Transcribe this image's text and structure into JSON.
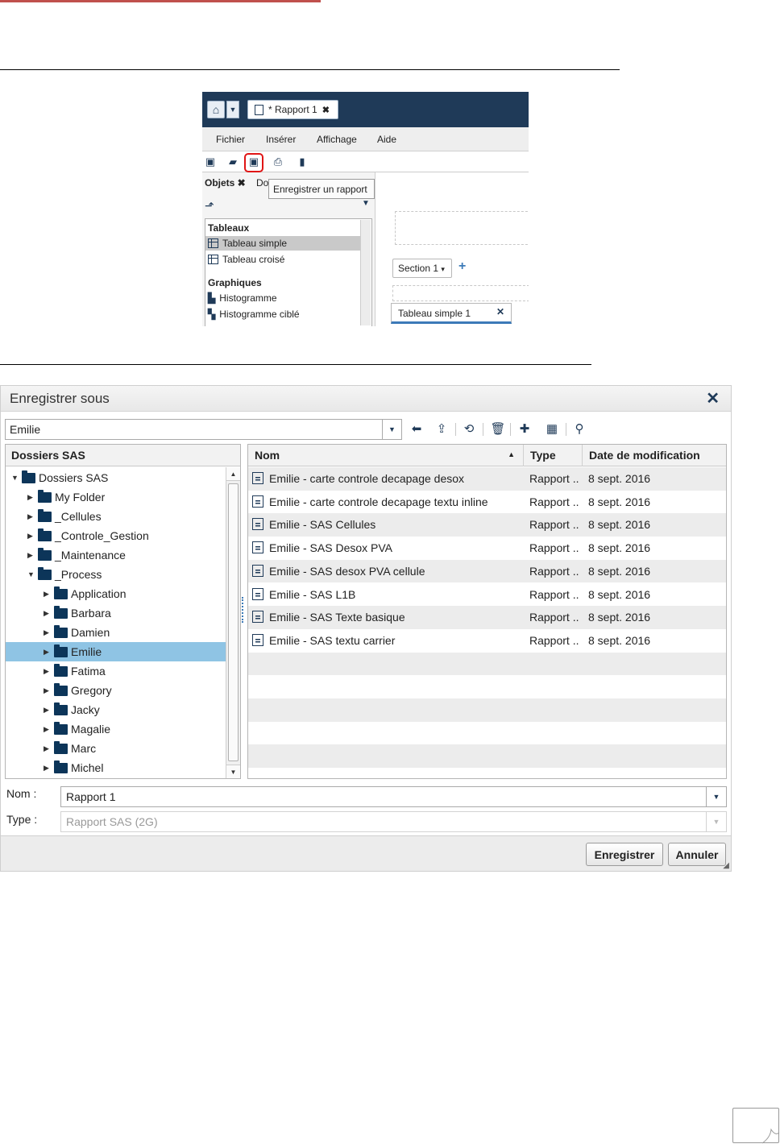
{
  "top_shot": {
    "report_tab": "* Rapport 1",
    "menu": [
      "Fichier",
      "Insérer",
      "Affichage",
      "Aide"
    ],
    "panel_tab_objects": "Objets",
    "panel_tab_data": "Do",
    "tooltip": "Enregistrer un rapport",
    "list": {
      "group1": "Tableaux",
      "item1": "Tableau simple",
      "item2": "Tableau croisé",
      "group2": "Graphiques",
      "item3": "Histogramme",
      "item4": "Histogramme ciblé"
    },
    "section_tab": "Section 1",
    "content_tab": "Tableau simple 1"
  },
  "dialog": {
    "title": "Enregistrer sous",
    "path": "Emilie",
    "tree_header": "Dossiers SAS",
    "tree": [
      {
        "label": "Dossiers SAS",
        "level": 0,
        "expanded": true
      },
      {
        "label": "My Folder",
        "level": 1,
        "expanded": false
      },
      {
        "label": "_Cellules",
        "level": 1,
        "expanded": false
      },
      {
        "label": "_Controle_Gestion",
        "level": 1,
        "expanded": false
      },
      {
        "label": "_Maintenance",
        "level": 1,
        "expanded": false
      },
      {
        "label": "_Process",
        "level": 1,
        "expanded": true
      },
      {
        "label": "Application",
        "level": 2,
        "expanded": false
      },
      {
        "label": "Barbara",
        "level": 2,
        "expanded": false
      },
      {
        "label": "Damien",
        "level": 2,
        "expanded": false
      },
      {
        "label": "Emilie",
        "level": 2,
        "expanded": false,
        "selected": true
      },
      {
        "label": "Fatima",
        "level": 2,
        "expanded": false
      },
      {
        "label": "Gregory",
        "level": 2,
        "expanded": false
      },
      {
        "label": "Jacky",
        "level": 2,
        "expanded": false
      },
      {
        "label": "Magalie",
        "level": 2,
        "expanded": false
      },
      {
        "label": "Marc",
        "level": 2,
        "expanded": false
      },
      {
        "label": "Michel",
        "level": 2,
        "expanded": false
      }
    ],
    "columns": [
      "Nom",
      "Type",
      "Date de modification"
    ],
    "files": [
      {
        "name": "Emilie - carte controle decapage desox",
        "type": "Rapport ..",
        "date": "8 sept. 2016"
      },
      {
        "name": "Emilie - carte controle decapage textu inline",
        "type": "Rapport ..",
        "date": "8 sept. 2016"
      },
      {
        "name": "Emilie - SAS Cellules",
        "type": "Rapport ..",
        "date": "8 sept. 2016"
      },
      {
        "name": "Emilie - SAS Desox PVA",
        "type": "Rapport ..",
        "date": "8 sept. 2016"
      },
      {
        "name": "Emilie - SAS desox PVA cellule",
        "type": "Rapport ..",
        "date": "8 sept. 2016"
      },
      {
        "name": "Emilie - SAS L1B",
        "type": "Rapport ..",
        "date": "8 sept. 2016"
      },
      {
        "name": "Emilie - SAS Texte basique",
        "type": "Rapport ..",
        "date": "8 sept. 2016"
      },
      {
        "name": "Emilie - SAS textu carrier",
        "type": "Rapport ..",
        "date": "8 sept. 2016"
      }
    ],
    "name_label": "Nom :",
    "name_value": "Rapport 1",
    "type_label": "Type :",
    "type_value": "Rapport SAS (2G)",
    "save_button": "Enregistrer",
    "cancel_button": "Annuler"
  }
}
